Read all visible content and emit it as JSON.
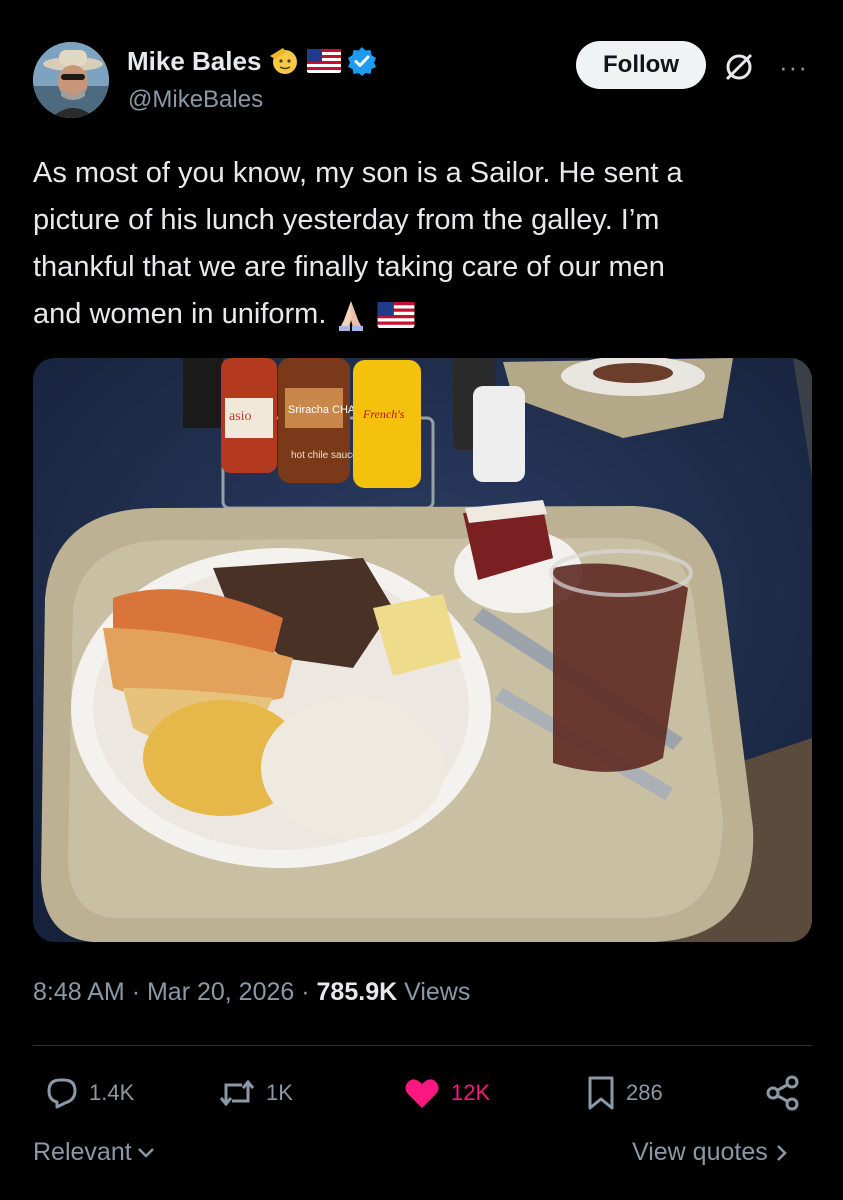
{
  "author": {
    "name": "Mike Bales",
    "handle": "@MikeBales",
    "verified": true,
    "badges": [
      "saluting-face-emoji",
      "us-flag-emoji",
      "verified-badge-icon"
    ]
  },
  "follow_label": "Follow",
  "tweet": {
    "lines": [
      "As most of you know, my son is a Sailor. He sent a",
      "picture of his lunch yesterday from the galley. I’m",
      "thankful that we are finally taking care of our men",
      "and women in uniform."
    ],
    "trailing_emojis": [
      "folded-hands-emoji",
      "us-flag-emoji"
    ]
  },
  "media": {
    "label_bottles": [
      "Sriracha CHA!",
      "hot chile sauce",
      "French's",
      "asio"
    ]
  },
  "meta": {
    "time": "8:48 AM",
    "date": "Mar 20, 2026",
    "views_count": "785.9K",
    "views_label": "Views"
  },
  "actions": {
    "replies": "1.4K",
    "reposts": "1K",
    "likes": "12K",
    "bookmarks": "286"
  },
  "footer": {
    "sort_label": "Relevant",
    "view_quotes_label": "View quotes"
  },
  "colors": {
    "background": "#000000",
    "text": "#e7e9ea",
    "muted": "#8b98a5",
    "like": "#f91880",
    "verified": "#1d9bf0"
  }
}
